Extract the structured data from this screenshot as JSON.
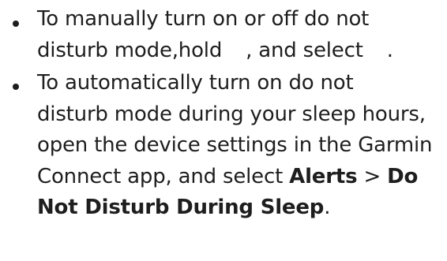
{
  "bullets": [
    {
      "lines": [
        "To manually turn on or off do not",
        "disturb mode,hold",
        ", and select",
        "."
      ]
    },
    {
      "lines": [
        "To automatically turn on do not",
        "disturb mode during your sleep hours,",
        "open the device settings in the Garmin",
        "Connect app, and select",
        "Alerts",
        ">",
        "Do",
        "Not Disturb During Sleep",
        "."
      ]
    }
  ]
}
